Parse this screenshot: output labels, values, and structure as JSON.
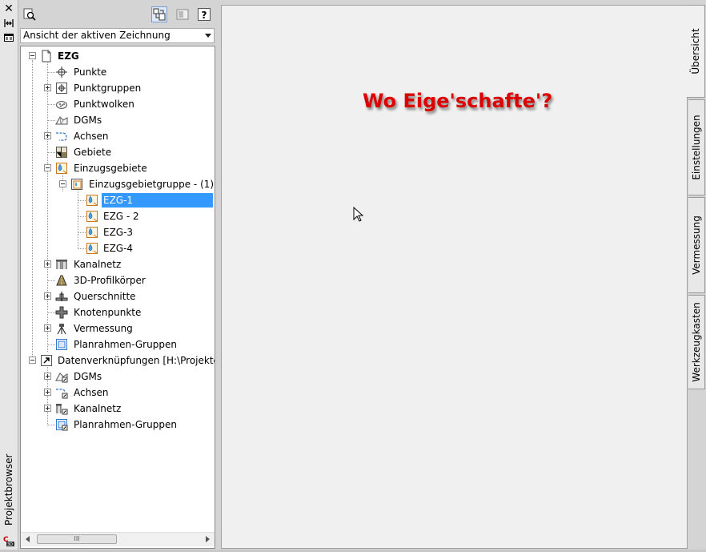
{
  "palette": {
    "title": "Projektbrowser"
  },
  "toolbar": {
    "dropdown_value": "Ansicht der aktiven Zeichnung"
  },
  "tree": {
    "root": "EZG",
    "items": [
      "Punkte",
      "Punktgruppen",
      "Punktwolken",
      "DGMs",
      "Achsen",
      "Gebiete",
      "Einzugsgebiete",
      "Einzugsgebietgruppe - (1)",
      "EZG-1",
      "EZG - 2",
      "EZG-3",
      "EZG-4",
      "Kanalnetz",
      "3D-Profilkörper",
      "Querschnitte",
      "Knotenpunkte",
      "Vermessung",
      "Planrahmen-Gruppen"
    ],
    "data_root": "Datenverknüpfungen [H:\\Projekte\\...",
    "data_items": [
      "DGMs",
      "Achsen",
      "Kanalnetz",
      "Planrahmen-Gruppen"
    ]
  },
  "scrollbar": {
    "thumb_grip": "III"
  },
  "main": {
    "annotation": "Wo Eige'schafte'?"
  },
  "tabs": [
    "Übersicht",
    "Einstellungen",
    "Vermessung",
    "Werkzeugkasten"
  ],
  "colors": {
    "selection": "#3399ff",
    "annotation": "#dd0000"
  }
}
